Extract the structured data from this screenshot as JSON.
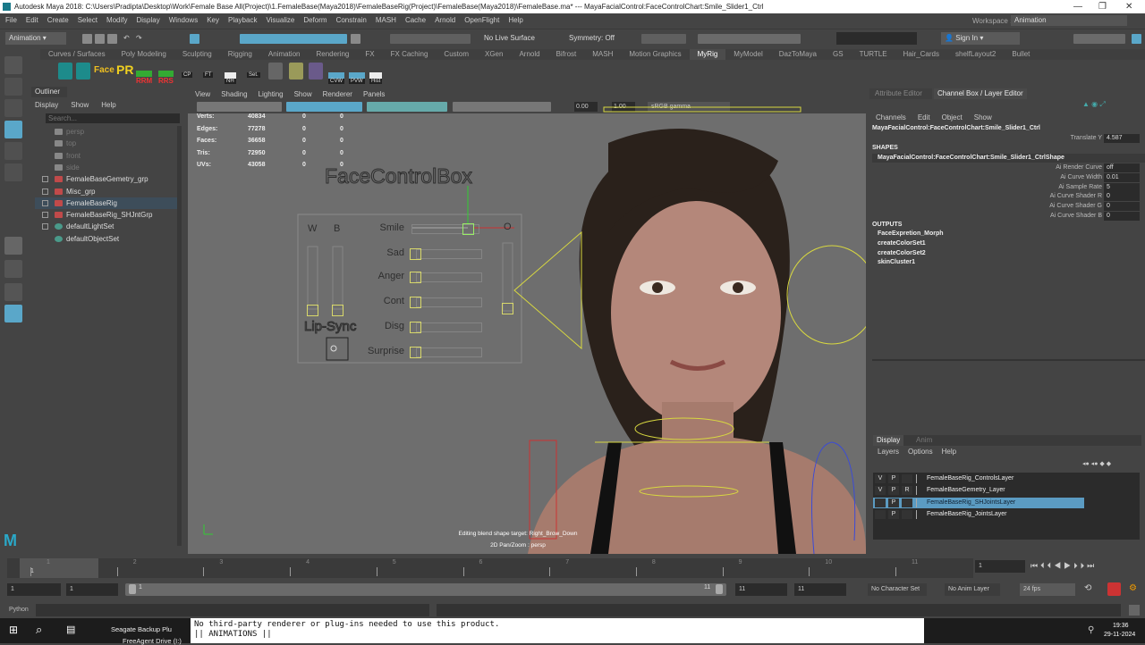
{
  "title": {
    "text": "Autodesk Maya 2018: C:\\Users\\Pradipta\\Desktop\\Work\\Female Base All(Project)\\1.FemaleBase(Maya2018)\\FemaleBaseRig(Project)\\FemaleBase(Maya2018)\\FemaleBase.ma*   ---   MayaFacialControl:FaceControlChart:Smile_Slider1_Ctrl",
    "minimize": "—",
    "maximize": "❐",
    "close": "✕"
  },
  "menu": [
    "File",
    "Edit",
    "Create",
    "Select",
    "Modify",
    "Display",
    "Windows",
    "Key",
    "Playback",
    "Visualize",
    "Deform",
    "Constrain",
    "MASH",
    "Cache",
    "Arnold",
    "OpenFlight",
    "Help"
  ],
  "status": {
    "menuset": "Animation",
    "live_surface": "No Live Surface",
    "symmetry": "Symmetry: Off",
    "sign_in": "Sign In",
    "workspace_label": "Workspace :",
    "workspace": "Animation"
  },
  "shelf_tabs": [
    "Curves / Surfaces",
    "Poly Modeling",
    "Sculpting",
    "Rigging",
    "Animation",
    "Rendering",
    "FX",
    "FX Caching",
    "Custom",
    "XGen",
    "Arnold",
    "Bifrost",
    "MASH",
    "Motion Graphics",
    "MyRig",
    "MyModel",
    "DazToMaya",
    "GS",
    "TURTLE",
    "Hair_Cards",
    "shelfLayout2",
    "Bullet"
  ],
  "shelf_active": "MyRig",
  "shelf_buttons": [
    "Face",
    "PR",
    "RRM",
    "RRS",
    "CP",
    "FT",
    "NH",
    "Set.",
    "CVW",
    "PVW",
    "Hist"
  ],
  "outliner": {
    "title": "Outliner",
    "menu": [
      "Display",
      "Show",
      "Help"
    ],
    "search_placeholder": "Search...",
    "items": [
      {
        "label": "persp",
        "type": "camera"
      },
      {
        "label": "top",
        "type": "camera"
      },
      {
        "label": "front",
        "type": "camera"
      },
      {
        "label": "side",
        "type": "camera"
      },
      {
        "label": "FemaleBaseGemetry_grp",
        "type": "group"
      },
      {
        "label": "Misc_grp",
        "type": "group"
      },
      {
        "label": "FemaleBaseRig",
        "type": "group",
        "selected": true
      },
      {
        "label": "FemaleBaseRig_SHJntGrp",
        "type": "group"
      },
      {
        "label": "defaultLightSet",
        "type": "set"
      },
      {
        "label": "defaultObjectSet",
        "type": "set"
      }
    ]
  },
  "viewport": {
    "menu": [
      "View",
      "Shading",
      "Lighting",
      "Show",
      "Renderer",
      "Panels"
    ],
    "exposure": "0.00",
    "gamma": "1.00",
    "colorspace": "sRGB gamma",
    "stats": [
      {
        "k": "Verts:",
        "v": "40834",
        "a": "0",
        "b": "0"
      },
      {
        "k": "Edges:",
        "v": "77278",
        "a": "0",
        "b": "0"
      },
      {
        "k": "Faces:",
        "v": "36658",
        "a": "0",
        "b": "0"
      },
      {
        "k": "Tris:",
        "v": "72950",
        "a": "0",
        "b": "0"
      },
      {
        "k": "UVs:",
        "v": "43058",
        "a": "0",
        "b": "0"
      }
    ],
    "face_box": {
      "title": "FaceControlBox",
      "w": "W",
      "b": "B",
      "o": "O",
      "lipsync": "Lip-Sync",
      "sliders": [
        "Smile",
        "Sad",
        "Anger",
        "Cont",
        "Disg",
        "Surprise"
      ]
    },
    "message": "Editing blend shape target: Right_Brow_Down",
    "camera_label": "2D Pan/Zoom : persp"
  },
  "right": {
    "tabs": [
      "Attribute Editor",
      "Channel Box / Layer Editor"
    ],
    "menu": [
      "Channels",
      "Edit",
      "Object",
      "Show"
    ],
    "object": "MayaFacialControl:FaceControlChart:Smile_Slider1_Ctrl",
    "channels": [
      {
        "k": "Translate Y",
        "v": "4.587"
      }
    ],
    "shapes_label": "SHAPES",
    "shape": "MayaFacialControl:FaceControlChart:Smile_Slider1_CtrlShape",
    "shape_channels": [
      {
        "k": "Ai Render Curve",
        "v": "off"
      },
      {
        "k": "Ai Curve Width",
        "v": "0.01"
      },
      {
        "k": "Ai Sample Rate",
        "v": "5"
      },
      {
        "k": "Ai Curve Shader R",
        "v": "0"
      },
      {
        "k": "Ai Curve Shader G",
        "v": "0"
      },
      {
        "k": "Ai Curve Shader B",
        "v": "0"
      }
    ],
    "outputs_label": "OUTPUTS",
    "outputs": [
      "FaceExpretion_Morph",
      "createColorSet1",
      "createColorSet2",
      "skinCluster1"
    ],
    "layer_tabs": [
      "Display",
      "Anim"
    ],
    "layer_menu": [
      "Layers",
      "Options",
      "Help"
    ],
    "layers": [
      {
        "v": "V",
        "p": "P",
        "r": "",
        "name": "FemaleBaseRig_ControlsLayer"
      },
      {
        "v": "V",
        "p": "P",
        "r": "R",
        "name": "FemaleBaseGemetry_Layer"
      },
      {
        "v": "",
        "p": "P",
        "r": "",
        "name": "FemaleBaseRig_SHJointsLayer",
        "selected": true
      },
      {
        "v": "",
        "p": "P",
        "r": "",
        "name": "FemaleBaseRig_JointsLayer"
      }
    ]
  },
  "timeline": {
    "ticks": [
      "1",
      "2",
      "3",
      "4",
      "5",
      "6",
      "7",
      "8",
      "9",
      "10",
      "11"
    ],
    "current": "1",
    "current_field": "1",
    "range_start": "1",
    "anim_start": "1",
    "range_handle_start": "1",
    "range_handle_end": "11",
    "range_end": "11",
    "anim_end": "11",
    "character_set": "No Character Set",
    "anim_layer": "No Anim Layer",
    "fps": "24 fps"
  },
  "cmdline": {
    "label": "Python"
  },
  "console": [
    "No third-party renderer or plug-ins needed to use this product.",
    "|| ANIMATIONS ||"
  ],
  "taskbar": {
    "item1": "Seagate Backup Plu",
    "item2": "FreeAgent Drive (I:)",
    "time": "19:36",
    "date": "29-11-2024"
  }
}
